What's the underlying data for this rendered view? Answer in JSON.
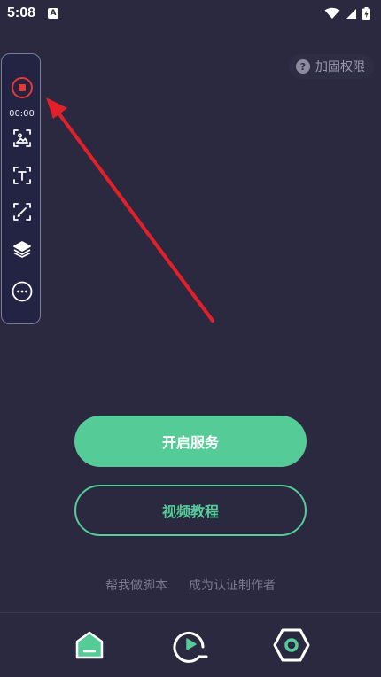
{
  "status_bar": {
    "time": "5:08",
    "notification_glyph": "A",
    "icons": [
      "wifi-icon",
      "cellular-signal-icon",
      "battery-charging-icon"
    ]
  },
  "permission_chip": {
    "icon": "help-icon",
    "icon_glyph": "?",
    "label": "加固权限"
  },
  "floating_toolbar": {
    "record_icon": "record-stop-icon",
    "timer": "00:00",
    "tools": [
      "image-capture-icon",
      "text-capture-icon",
      "edit-area-icon",
      "layers-icon",
      "more-icon"
    ]
  },
  "main": {
    "start_service_label": "开启服务",
    "video_tutorial_label": "视频教程",
    "links": [
      "帮我做脚本",
      "成为认证制作者"
    ]
  },
  "bottom_nav": {
    "items": [
      "home-icon",
      "play-icon",
      "settings-icon"
    ]
  },
  "colors": {
    "background": "#2a2940",
    "accent": "#55cb97",
    "record_red": "#e53935",
    "arrow_red": "#e3202a"
  }
}
